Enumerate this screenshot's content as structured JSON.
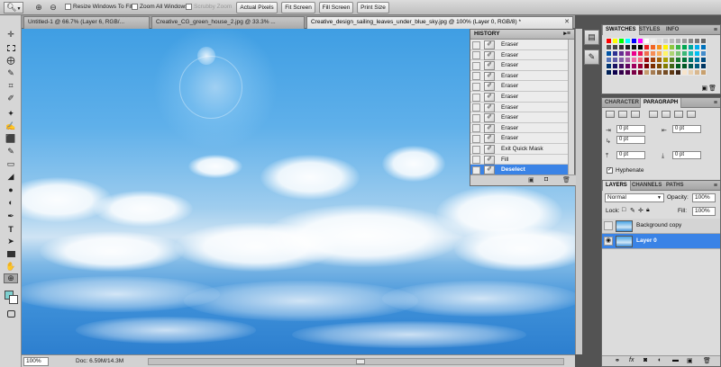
{
  "options_bar": {
    "tool_icon": "zoom-icon",
    "resize_windows": "Resize Windows To Fit",
    "zoom_all": "Zoom All Windows",
    "scrubby_zoom": "Scrubby Zoom",
    "actual_pixels": "Actual Pixels",
    "fit_screen": "Fit Screen",
    "fill_screen": "Fill Screen",
    "print_size": "Print Size"
  },
  "doc_tabs": [
    {
      "label": "Untitled-1 @ 66.7% (Layer 6, RGB/..."
    },
    {
      "label": "Creative_CG_green_house_2.jpg @ 33.3% ..."
    },
    {
      "label": "Creative_design_sailing_leaves_under_blue_sky.jpg @ 100% (Layer 0, RGB/8) *",
      "active": true
    }
  ],
  "history": {
    "title": "HISTORY",
    "items": [
      "Eraser",
      "Eraser",
      "Eraser",
      "Eraser",
      "Eraser",
      "Eraser",
      "Eraser",
      "Eraser",
      "Eraser",
      "Eraser",
      "Exit Quick Mask",
      "Fill",
      "Deselect"
    ],
    "selected_index": 12
  },
  "swatches_panel": {
    "tabs": [
      "SWATCHES",
      "STYLES",
      "INFO"
    ],
    "colors": [
      "#ff0000",
      "#ffff00",
      "#00ff00",
      "#00ffff",
      "#0000ff",
      "#ff00ff",
      "#ffffff",
      "#eeeeee",
      "#dddddd",
      "#cccccc",
      "#bbbbbb",
      "#aaaaaa",
      "#999999",
      "#888888",
      "#777777",
      "#666666",
      "#555555",
      "#444444",
      "#333333",
      "#222222",
      "#111111",
      "#000000",
      "#ee1d24",
      "#f26522",
      "#f7941d",
      "#fff200",
      "#8dc63f",
      "#39b54a",
      "#00a651",
      "#00a99d",
      "#00aeef",
      "#0072bc",
      "#0054a6",
      "#2e3192",
      "#662d91",
      "#92278f",
      "#ec008c",
      "#ed145b",
      "#f26c4f",
      "#f68e56",
      "#fbaf5d",
      "#fff568",
      "#acd373",
      "#7cc576",
      "#3cb878",
      "#1cbbb4",
      "#00bff3",
      "#448ccb",
      "#5674b9",
      "#605ca8",
      "#8560a8",
      "#a864a8",
      "#f06eaa",
      "#f26d7d",
      "#9e0b0f",
      "#a0410d",
      "#a36209",
      "#aba000",
      "#598527",
      "#1a7b30",
      "#007236",
      "#00746b",
      "#0076a3",
      "#004b80",
      "#003471",
      "#1b1464",
      "#440e62",
      "#630460",
      "#9e005d",
      "#9e0039",
      "#790000",
      "#7b2e00",
      "#7d4900",
      "#827b00",
      "#406618",
      "#005e20",
      "#005826",
      "#005952",
      "#005b7f",
      "#003663",
      "#002157",
      "#0d004c",
      "#32004b",
      "#4b0049",
      "#7b0046",
      "#7a0026",
      "#c69c6d",
      "#a67c52",
      "#8c6239",
      "#754c24",
      "#603913",
      "#3c2415",
      "#f7e4cb",
      "#e8d0b0",
      "#d9b88f",
      "#c8a06e"
    ]
  },
  "character_panel": {
    "tabs": [
      "CHARACTER",
      "PARAGRAPH"
    ],
    "indent_left": "0 pt",
    "indent_right": "0 pt",
    "first_line": "0 pt",
    "space_before": "0 pt",
    "space_after": "0 pt",
    "hyphenate": "Hyphenate"
  },
  "layers_panel": {
    "tabs": [
      "LAYERS",
      "CHANNELS",
      "PATHS"
    ],
    "blend_mode": "Normal",
    "opacity_label": "Opacity:",
    "opacity": "100%",
    "lock_label": "Lock:",
    "fill_label": "Fill:",
    "fill": "100%",
    "layers": [
      {
        "name": "Background copy",
        "visible": false
      },
      {
        "name": "Layer 0",
        "visible": true,
        "selected": true
      }
    ]
  },
  "status_bar": {
    "zoom": "100%",
    "doc": "Doc: 6.59M/14.3M"
  }
}
